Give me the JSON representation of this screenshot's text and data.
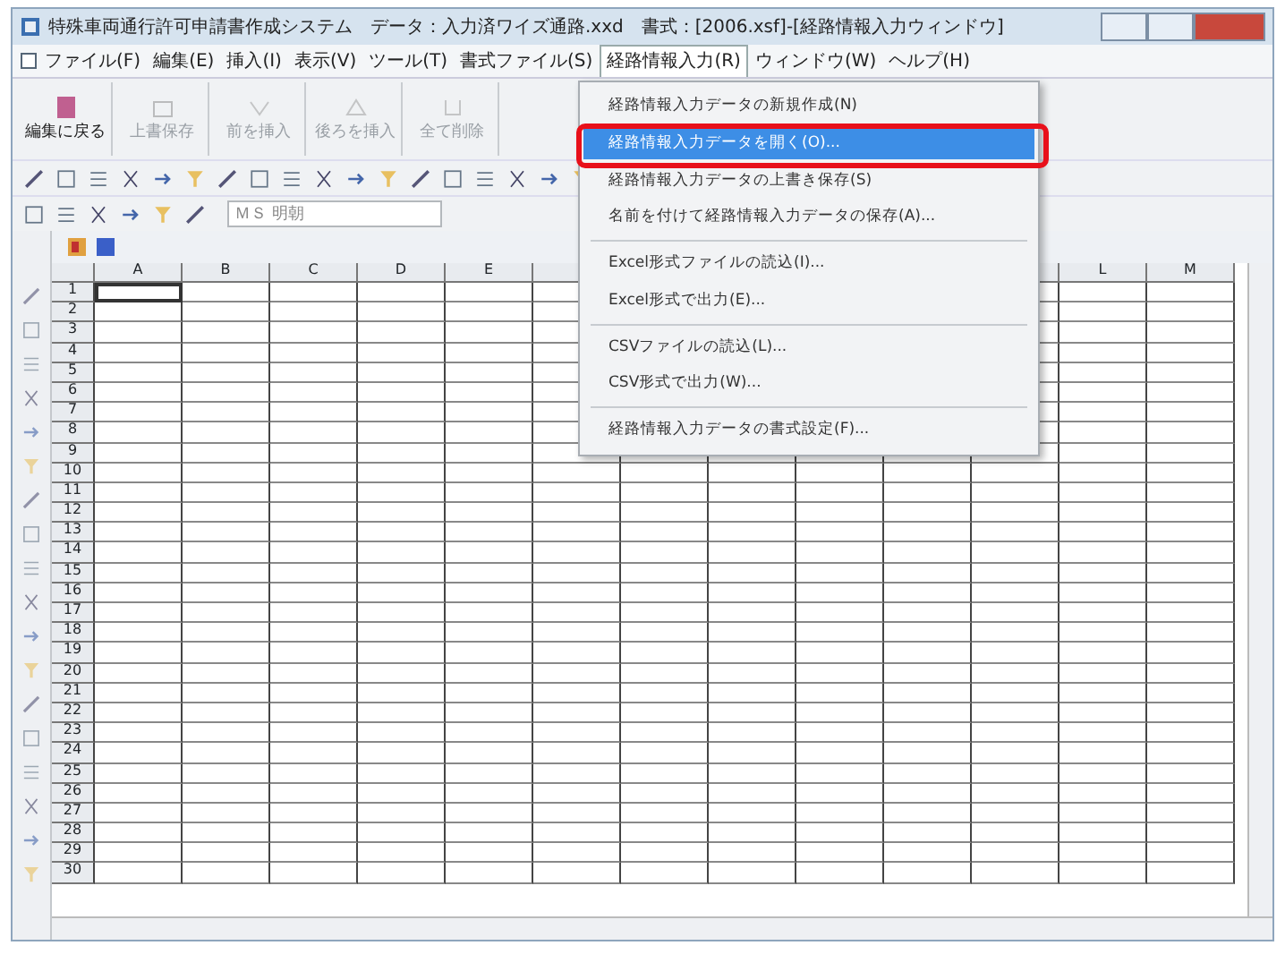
{
  "window": {
    "title": "特殊車両通行許可申請書作成システム　データ：入力済ワイズ通路.xxd　書式：[2006.xsf]-[経路情報入力ウィンドウ]"
  },
  "menu_bar": [
    {
      "label": "ファイル(F)",
      "selected": false
    },
    {
      "label": "編集(E)",
      "selected": false
    },
    {
      "label": "挿入(I)",
      "selected": false
    },
    {
      "label": "表示(V)",
      "selected": false
    },
    {
      "label": "ツール(T)",
      "selected": false
    },
    {
      "label": "書式ファイル(S)",
      "selected": false
    },
    {
      "label": "経路情報入力(R)",
      "selected": true
    },
    {
      "label": "ウィンドウ(W)",
      "selected": false
    },
    {
      "label": "ヘルプ(H)",
      "selected": false
    }
  ],
  "toolbar": [
    {
      "label": "編集に戻る",
      "disabled": false
    },
    {
      "label": "上書保存",
      "disabled": true
    },
    {
      "label": "前を挿入",
      "disabled": true
    },
    {
      "label": "後ろを挿入",
      "disabled": true
    },
    {
      "label": "全て削除",
      "disabled": true
    }
  ],
  "font_box": {
    "value": "ＭＳ 明朝"
  },
  "dropdown": {
    "sections": [
      [
        {
          "label": "経路情報入力データの新規作成(N)",
          "selected": false
        },
        {
          "label": "経路情報入力データを開く(O)...",
          "selected": true
        },
        {
          "label": "経路情報入力データの上書き保存(S)",
          "selected": false
        },
        {
          "label": "名前を付けて経路情報入力データの保存(A)...",
          "selected": false
        }
      ],
      [
        {
          "label": "Excel形式ファイルの読込(I)...",
          "selected": false
        },
        {
          "label": "Excel形式で出力(E)...",
          "selected": false
        }
      ],
      [
        {
          "label": "CSVファイルの読込(L)...",
          "selected": false
        },
        {
          "label": "CSV形式で出力(W)...",
          "selected": false
        }
      ],
      [
        {
          "label": "経路情報入力データの書式設定(F)...",
          "selected": false
        }
      ]
    ]
  },
  "sheet": {
    "columns_left": [
      "A",
      "B",
      "C",
      "D",
      "E"
    ],
    "columns_right": [
      "L",
      "M"
    ],
    "rows": [
      "1",
      "2",
      "3",
      "4",
      "5",
      "6",
      "7",
      "8",
      "9",
      "10",
      "11",
      "12",
      "13",
      "14",
      "15",
      "16",
      "17",
      "18",
      "19",
      "20",
      "21",
      "22",
      "23",
      "24",
      "25",
      "26",
      "27",
      "28",
      "29",
      "30"
    ]
  }
}
